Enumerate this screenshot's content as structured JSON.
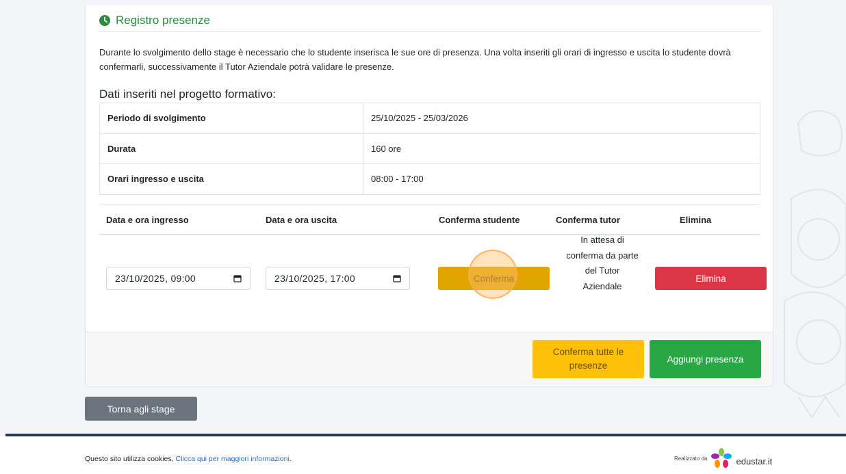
{
  "section": {
    "title": "Registro presenze"
  },
  "intro": "Durante lo svolgimento dello stage è necessario che lo studente inserisca le sue ore di presenza. Una volta inseriti gli orari di ingresso e uscita lo studente dovrà confermarli, successivamente il Tutor Aziendale potrà validare le presenze.",
  "project": {
    "heading": "Dati inseriti nel progetto formativo:",
    "rows": [
      {
        "label": "Periodo di svolgimento",
        "value": "25/10/2025 - 25/03/2026"
      },
      {
        "label": "Durata",
        "value": "160 ore"
      },
      {
        "label": "Orari ingresso e uscita",
        "value": "08:00 - 17:00"
      }
    ]
  },
  "attendance": {
    "headers": {
      "entry": "Data e ora ingresso",
      "exit": "Data e ora uscita",
      "student_confirm": "Conferma studente",
      "tutor_confirm": "Conferma tutor",
      "delete": "Elimina"
    },
    "rows": [
      {
        "entry": "23/10/2025, 09:00",
        "exit": "23/10/2025, 17:00",
        "confirm_label": "Conferma",
        "tutor_status": "In attesa di conferma da parte del Tutor Aziendale",
        "delete_label": "Elimina"
      }
    ]
  },
  "actions": {
    "confirm_all": "Conferma tutte le presenze",
    "add": "Aggiungi presenza",
    "back": "Torna agli stage"
  },
  "footer": {
    "cookie_text": "Questo sito utilizza cookies, ",
    "cookie_link": "Clicca qui per maggiori informazioni",
    "cookie_end": ".",
    "credit_prefix": "Realizzato da",
    "credit_brand": "edustar.it"
  },
  "colors": {
    "accent_green": "#2e8b3d",
    "confirm_yellow": "#ffc107",
    "danger_red": "#dc3545",
    "success_green": "#28a745",
    "footer_navy": "#253a52"
  },
  "icons": [
    "clock-icon",
    "calendar-icon",
    "edustar-logo"
  ]
}
